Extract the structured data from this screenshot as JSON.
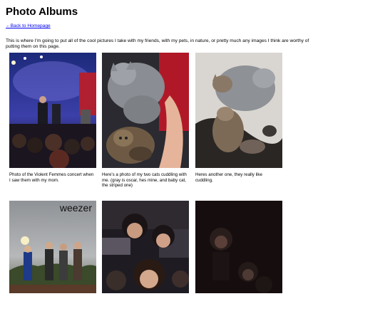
{
  "title": "Photo Albums",
  "back_link": "←Back to Homepage",
  "intro": "This is where I'm going to put all of the cool pictures I take with my friends, with my pets, in nature, or pretty much any images I think are worthy of putting them on this page.",
  "photos": [
    {
      "caption": "Photo of the Violent Femmes concert when I saw them with my mom.",
      "icon": "concert-photo"
    },
    {
      "caption": "Here's a photo of my two cats cuddling with me. (gray is oscar, hes mine, and baby cat, the striped one)",
      "icon": "cats-cuddling-photo"
    },
    {
      "caption": "Heres another one, they really like cuddling.",
      "icon": "cats-photo"
    },
    {
      "caption": "",
      "icon": "band-photo",
      "overlay_text": "weezer"
    },
    {
      "caption": "",
      "icon": "friends-selfie-photo"
    },
    {
      "caption": "",
      "icon": "dark-selfie-photo"
    }
  ]
}
